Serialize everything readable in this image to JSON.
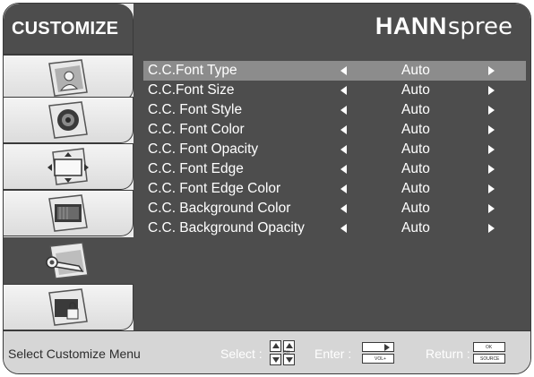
{
  "menu_title": "CUSTOMIZE",
  "brand": {
    "bold": "HANN",
    "light": "spree"
  },
  "tabs": [
    {
      "id": "picture",
      "icon": "person-picture-icon"
    },
    {
      "id": "sound",
      "icon": "speaker-icon"
    },
    {
      "id": "setup",
      "icon": "screen-setup-icon"
    },
    {
      "id": "channel",
      "icon": "tv-screen-icon"
    },
    {
      "id": "customize",
      "icon": "wrench-icon",
      "active": true
    },
    {
      "id": "lock",
      "icon": "lock-icon"
    }
  ],
  "menu_items": [
    {
      "label": "C.C.Font Type",
      "value": "Auto",
      "selected": true
    },
    {
      "label": "C.C.Font Size",
      "value": "Auto"
    },
    {
      "label": "C.C. Font Style",
      "value": "Auto"
    },
    {
      "label": "C.C. Font Color",
      "value": "Auto"
    },
    {
      "label": "C.C. Font Opacity",
      "value": "Auto"
    },
    {
      "label": "C.C. Font Edge",
      "value": "Auto"
    },
    {
      "label": "C.C. Font Edge Color",
      "value": "Auto"
    },
    {
      "label": "C.C. Background Color",
      "value": "Auto"
    },
    {
      "label": "C.C. Background Opacity",
      "value": "Auto"
    }
  ],
  "footer": {
    "status": "Select Customize Menu",
    "select_label": "Select :",
    "select_key": "CH",
    "enter_label": "Enter :",
    "enter_key": "VOL+",
    "return_label": "Return :",
    "return_key_top": "OK",
    "return_key_bottom": "SOURCE"
  },
  "colors": {
    "panel_dark": "#4d4d4d",
    "panel_light": "#ececec",
    "selected_row": "#8c8c8c",
    "footer": "#d6d6d6",
    "text": "#ffffff"
  }
}
